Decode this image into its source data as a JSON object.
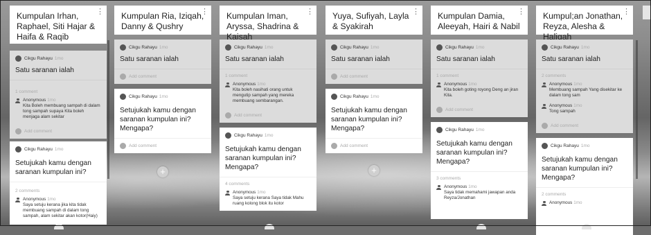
{
  "columns": [
    {
      "title": "Kumpulan Irhan, Raphael, Siti Hajar & Haifa & Raqib",
      "cards": [
        {
          "author": "Cikgu Rahayu",
          "time": "1mo",
          "text": "Satu saranan ialah",
          "count": "1 comment",
          "comments": [
            {
              "name": "Anonymous",
              "time": "1mo",
              "text": "Kita Boleh membuang sampah di dalam tong sampah supaya Kita boleh menjaga alam sekitar"
            }
          ],
          "add": "Add comment"
        },
        {
          "author": "Cikgu Rahayu",
          "time": "1mo",
          "text": "Setujukah kamu dengan saranan kumpulan ini?",
          "count": "2 comments",
          "comments": [
            {
              "name": "Anonymous",
              "time": "1mo",
              "text": "Saya setuju kerana jika kita tidak membuang sampah di dalam tong sampah, alam sekitar akan kotor(Haiy)"
            }
          ],
          "add": ""
        }
      ]
    },
    {
      "title": "Kumpulan Ria, Iziqah, Danny & Qushry",
      "cards": [
        {
          "author": "Cikgu Rahayu",
          "time": "1mo",
          "text": "Satu saranan ialah",
          "count": "",
          "comments": [],
          "add": "Add comment"
        },
        {
          "author": "Cikgu Rahayu",
          "time": "1mo",
          "text": "Setujukah kamu dengan saranan kumpulan ini? Mengapa?",
          "count": "",
          "comments": [],
          "add": "Add comment"
        }
      ]
    },
    {
      "title": "Kumpulan Iman, Aryssa, Shadrina & Kaisah",
      "cards": [
        {
          "author": "Cikgu Rahayu",
          "time": "1mo",
          "text": "Satu saranan ialah",
          "count": "1 comment",
          "comments": [
            {
              "name": "Anonymous",
              "time": "1mo",
              "text": "Kita boleh nasihati orang untuk mengutip sampah yang mereka membuang sembarangan."
            }
          ],
          "add": "Add comment"
        },
        {
          "author": "Cikgu Rahayu",
          "time": "1mo",
          "text": "Setujukah kamu dengan saranan kumpulan ini? Mengapa?",
          "count": "4 comments",
          "comments": [
            {
              "name": "Anonymous",
              "time": "1mo",
              "text": "Saya setuju kerana Saya tidak Mahu ruang kolong blok itu kotor"
            }
          ],
          "add": ""
        }
      ]
    },
    {
      "title": "Yuya, Sufiyah, Layla & Syakirah",
      "cards": [
        {
          "author": "Cikgu Rahayu",
          "time": "1mo",
          "text": "Satu saranan ialah",
          "count": "",
          "comments": [],
          "add": "Add comment"
        },
        {
          "author": "Cikgu Rahayu",
          "time": "1mo",
          "text": "Setujukah kamu dengan saranan kumpulan ini? Mengapa?",
          "count": "",
          "comments": [],
          "add": "Add comment"
        }
      ]
    },
    {
      "title": "Kumpulan Damia, Aleeyah, Hairi & Nabil",
      "cards": [
        {
          "author": "Cikgu Rahayu",
          "time": "1mo",
          "text": "Satu saranan ialah",
          "count": "1 comment",
          "comments": [
            {
              "name": "Anonymous",
              "time": "1mo",
              "text": "Kita boleh goting royong Deng an jiran Kita."
            }
          ],
          "add": "Add comment"
        },
        {
          "author": "Cikgu Rahayu",
          "time": "1mo",
          "text": "Setujukah kamu dengan saranan kumpulan ini? Mengapa?",
          "count": "3 comments",
          "comments": [
            {
              "name": "Anonymous",
              "time": "1mo",
              "text": "Saya tidak memahami jawapan anda Reyza/Jonathan"
            }
          ],
          "add": ""
        }
      ]
    },
    {
      "title": "Kumpul;an Jonathan, Reyza, Alesha & Haliqah",
      "cards": [
        {
          "author": "Cikgu Rahayu",
          "time": "1mo",
          "text": "Satu saranan ialah",
          "count": "2 comments",
          "comments": [
            {
              "name": "Anonymous",
              "time": "1mo",
              "text": "Membuang sampah Yang disekitar ke dalam tong sam"
            },
            {
              "name": "Anonymous",
              "time": "1mo",
              "text": "Tong sampah"
            }
          ],
          "add": "Add comment"
        },
        {
          "author": "Cikgu Rahayu",
          "time": "1mo",
          "text": "Setujukah kamu dengan saranan kumpulan ini? Mengapa?",
          "count": "2 comments",
          "comments": [
            {
              "name": "Anonymous",
              "time": "1mo",
              "text": ""
            }
          ],
          "add": ""
        }
      ]
    }
  ],
  "kebab_icon": "⋮",
  "plus_icon": "+"
}
